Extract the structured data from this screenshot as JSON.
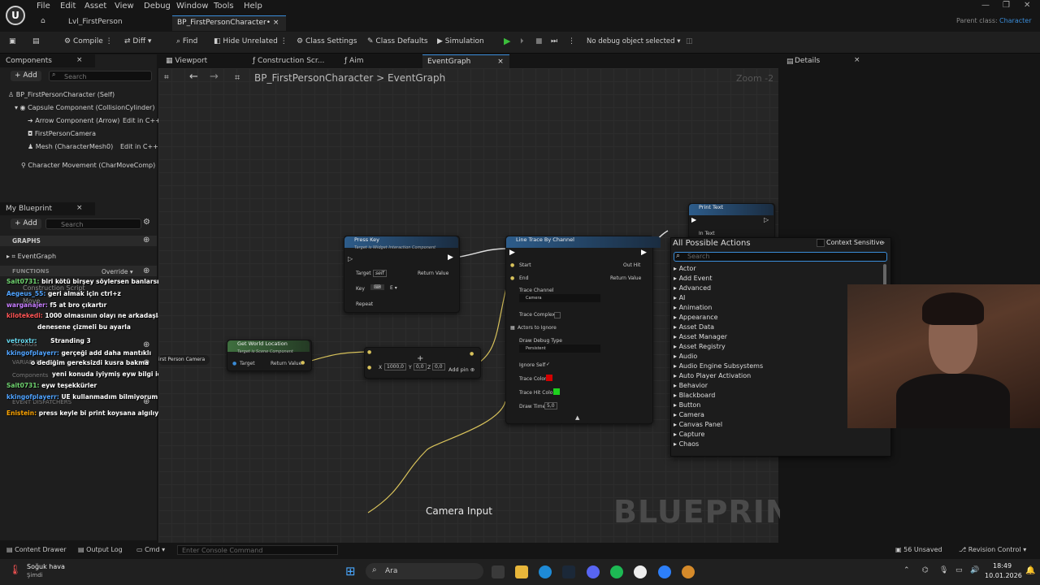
{
  "menubar": {
    "items": [
      "File",
      "Edit",
      "Asset",
      "View",
      "Debug",
      "Window",
      "Tools",
      "Help"
    ],
    "tabs": [
      {
        "label": "Lvl_FirstPerson"
      },
      {
        "label": "BP_FirstPersonCharacter•"
      }
    ],
    "parent_class_label": "Parent class:",
    "parent_class_value": "Character"
  },
  "toolbar": {
    "compile": "Compile",
    "diff": "Diff",
    "find": "Find",
    "hide_unrelated": "Hide Unrelated",
    "class_settings": "Class Settings",
    "class_defaults": "Class Defaults",
    "simulation": "Simulation",
    "debug_select": "No debug object selected"
  },
  "components": {
    "title": "Components",
    "add": "Add",
    "search_placeholder": "Search",
    "items": [
      {
        "label": "BP_FirstPersonCharacter (Self)"
      },
      {
        "label": "Capsule Component (CollisionCylinder)"
      },
      {
        "label": "Arrow Component (Arrow)",
        "extra": "Edit in C++"
      },
      {
        "label": "FirstPersonCamera"
      },
      {
        "label": "Mesh (CharacterMesh0)",
        "extra": "Edit in C++"
      },
      {
        "label": "Character Movement (CharMoveComp)"
      }
    ]
  },
  "my_blueprint": {
    "title": "My Blueprint",
    "add": "Add",
    "search_placeholder": "Search",
    "graphs": "GRAPHS",
    "event_graph": "EventGraph",
    "functions": "FUNCTIONS",
    "override": "Override",
    "construction_script": "Construction Script",
    "move": "Move",
    "macros": "MACROS",
    "variables": "VARIABLES",
    "components": "Components",
    "dispatchers": "EVENT DISPATCHERS"
  },
  "chat": [
    {
      "user": "Sait0731:",
      "msg": "biri kötü birşey söylersen banlarsın",
      "color": "#6fd36f"
    },
    {
      "user": "Aegeus_55:",
      "msg": "geri almak için ctrl+z",
      "color": "#4fa3ff"
    },
    {
      "user": "warganajer:",
      "msg": "f5 at bro çıkartır",
      "color": "#c77dff"
    },
    {
      "user": "kilotekedi:",
      "msg": "1000 olmasının olayı ne arkadaşlar",
      "color": "#ff5555"
    },
    {
      "user": "",
      "msg": "denesene çizmeli bu ayarla",
      "color": "#ff5555"
    },
    {
      "user": "vetroxtr:",
      "msg": "Stranding 3",
      "color": "#66d9ef"
    },
    {
      "user": "kkingofplayerr:",
      "msg": "gerçeği add daha mantıklı",
      "color": "#4fa3ff"
    },
    {
      "user": "",
      "msg": "o dediğim gereksizdi kusra bakma",
      "color": "#4fa3ff"
    },
    {
      "user": "",
      "msg": "yeni konuda iyiymiş eyw bilgi için",
      "color": "#66d9ef"
    },
    {
      "user": "Sait0731:",
      "msg": "eyw teşekkürler",
      "color": "#6fd36f"
    },
    {
      "user": "kkingofplayerr:",
      "msg": "UE kullanmadım bilmiyorum",
      "color": "#4fa3ff"
    },
    {
      "user": "",
      "msg": "press keyle bi print koysana algılıyo mu",
      "color": "#4fa3ff"
    },
    {
      "user": "Enistein:",
      "msg": "press keyle bi print koysana algılıyo mu",
      "color": "#ffa500"
    }
  ],
  "editor_tabs": [
    {
      "label": "Viewport"
    },
    {
      "label": "Construction Scr..."
    },
    {
      "label": "Aim"
    },
    {
      "label": "EventGraph"
    }
  ],
  "breadcrumb": {
    "root": "BP_FirstPersonCharacter",
    "sep": ">",
    "leaf": "EventGraph"
  },
  "zoom": "Zoom -2",
  "details_title": "Details",
  "nodes": {
    "press_key": {
      "title": "Press Key",
      "sub": "Target is Widget Interaction Component",
      "target": "Target",
      "self": "self",
      "return": "Return Value",
      "key": "Key",
      "repeat": "Repeat"
    },
    "line_trace": {
      "title": "Line Trace By Channel",
      "start": "Start",
      "end": "End",
      "out_hit": "Out Hit",
      "return": "Return Value",
      "trace_channel": "Trace Channel",
      "channel_value": "Camera",
      "trace_complex": "Trace Complex",
      "actors_ignore": "Actors to Ignore",
      "draw_debug": "Draw Debug Type",
      "debug_value": "Persistent",
      "ignore_self": "Ignore Self",
      "trace_color": "Trace Color",
      "trace_hit_color": "Trace Hit Color",
      "draw_time": "Draw Time",
      "draw_time_value": "5,0"
    },
    "get_world": {
      "title": "Get World Location",
      "sub": "Target is Scene Component",
      "target": "Target",
      "return": "Return Value"
    },
    "add": {
      "x": "1000,0",
      "y": "0,0",
      "z": "0,0",
      "add_pin": "Add pin"
    },
    "print_text": {
      "title": "Print Text",
      "in_text": "In Text"
    },
    "camera_ref": "irst Person Camera"
  },
  "comment_label": "Camera Input",
  "watermark": "BLUEPRINT",
  "actions_menu": {
    "title": "All Possible Actions",
    "context": "Context Sensitive",
    "search_placeholder": "Search",
    "items": [
      "Actor",
      "Add Event",
      "Advanced",
      "AI",
      "Animation",
      "Appearance",
      "Asset Data",
      "Asset Manager",
      "Asset Registry",
      "Audio",
      "Audio Engine Subsystems",
      "Auto Player Activation",
      "Behavior",
      "Blackboard",
      "Button",
      "Camera",
      "Canvas Panel",
      "Capture",
      "Chaos"
    ]
  },
  "status": {
    "content_drawer": "Content Drawer",
    "output_log": "Output Log",
    "cmd": "Cmd",
    "console_placeholder": "Enter Console Command",
    "unsaved": "56 Unsaved",
    "revision": "Revision Control"
  },
  "taskbar": {
    "weather_title": "Soğuk hava",
    "weather_sub": "Şimdi",
    "search": "Ara",
    "time": "18:49",
    "date": "10.01.2026"
  },
  "colors": {
    "accent": "#3a8cd8",
    "node_blue": "#2d5c8a",
    "node_green": "#3f6f3f",
    "exec": "#ffffff",
    "trace_red": "#d40000",
    "trace_green": "#1ed11e"
  }
}
